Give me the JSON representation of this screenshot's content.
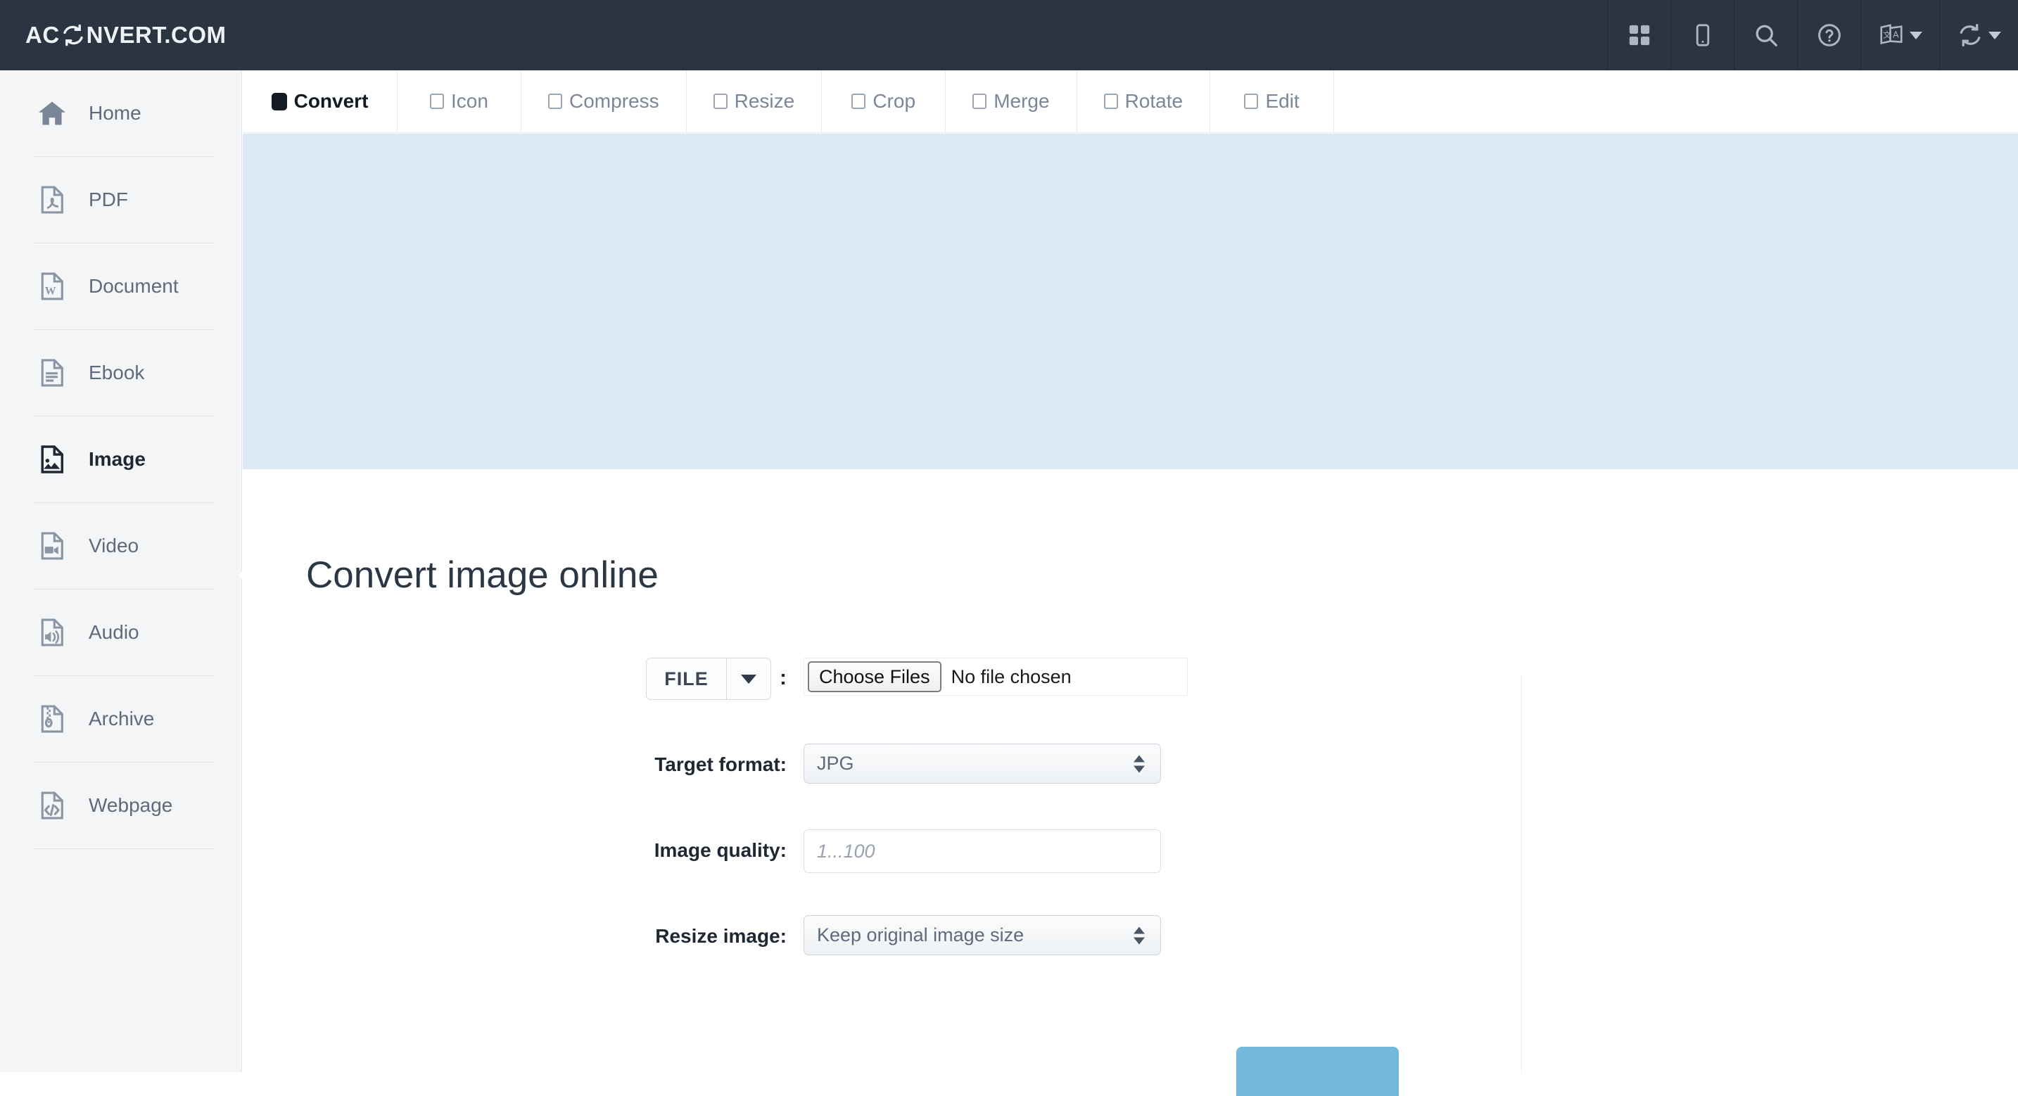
{
  "header": {
    "brand_prefix": "AC",
    "brand_icon": "convert-circular-arrows-icon",
    "brand_suffix": "NVERT.COM",
    "icons": [
      {
        "name": "apps-grid-icon",
        "caret": false
      },
      {
        "name": "mobile-phone-icon",
        "caret": false
      },
      {
        "name": "search-icon",
        "caret": false
      },
      {
        "name": "help-circle-icon",
        "caret": false
      },
      {
        "name": "translate-language-icon",
        "caret": true
      },
      {
        "name": "convert-refresh-icon",
        "caret": true
      }
    ]
  },
  "sidebar": {
    "items": [
      {
        "label": "Home",
        "icon": "home-icon",
        "active": false
      },
      {
        "label": "PDF",
        "icon": "pdf-file-icon",
        "active": false
      },
      {
        "label": "Document",
        "icon": "word-document-icon",
        "active": false
      },
      {
        "label": "Ebook",
        "icon": "ebook-file-icon",
        "active": false
      },
      {
        "label": "Image",
        "icon": "image-file-icon",
        "active": true
      },
      {
        "label": "Video",
        "icon": "video-file-icon",
        "active": false
      },
      {
        "label": "Audio",
        "icon": "audio-file-icon",
        "active": false
      },
      {
        "label": "Archive",
        "icon": "archive-zip-icon",
        "active": false
      },
      {
        "label": "Webpage",
        "icon": "code-webpage-icon",
        "active": false
      }
    ]
  },
  "tabs": [
    {
      "label": "Convert",
      "active": true
    },
    {
      "label": "Icon",
      "active": false
    },
    {
      "label": "Compress",
      "active": false
    },
    {
      "label": "Resize",
      "active": false
    },
    {
      "label": "Crop",
      "active": false
    },
    {
      "label": "Merge",
      "active": false
    },
    {
      "label": "Rotate",
      "active": false
    },
    {
      "label": "Edit",
      "active": false
    }
  ],
  "main": {
    "title": "Convert image online",
    "source_button": {
      "label": "FILE",
      "caret_icon": "chevron-down-icon"
    },
    "colon": ":",
    "file_input": {
      "button_label": "Choose Files",
      "status": "No file chosen"
    },
    "fields": [
      {
        "label": "Target format:",
        "type": "select",
        "value": "JPG"
      },
      {
        "label": "Image quality:",
        "type": "text",
        "value": "",
        "placeholder": "1...100"
      },
      {
        "label": "Resize image:",
        "type": "select",
        "value": "Keep original image size"
      }
    ],
    "submit_button": {
      "label": "",
      "color": "#73b9dd"
    }
  },
  "colors": {
    "header_bg": "#2b3441",
    "sidebar_bg": "#f4f5f6",
    "banner_bg": "#dde9f5",
    "accent": "#73b9dd",
    "text_dark": "#1f2733",
    "text_muted": "#7b8798"
  }
}
